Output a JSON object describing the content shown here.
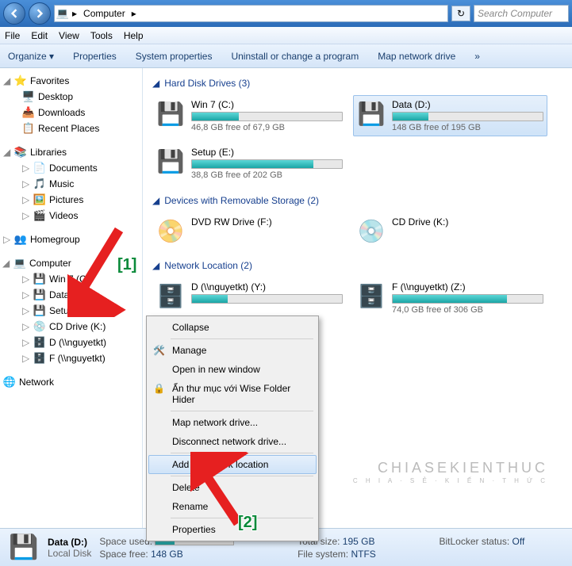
{
  "header": {
    "breadcrumb_root": "Computer",
    "search_placeholder": "Search Computer"
  },
  "menu": {
    "file": "File",
    "edit": "Edit",
    "view": "View",
    "tools": "Tools",
    "help": "Help"
  },
  "toolbar": {
    "organize": "Organize",
    "properties": "Properties",
    "sysprops": "System properties",
    "uninstall": "Uninstall or change a program",
    "mapdrive": "Map network drive",
    "overflow": "»"
  },
  "tree": {
    "favorites": {
      "label": "Favorites",
      "items": [
        "Desktop",
        "Downloads",
        "Recent Places"
      ]
    },
    "libraries": {
      "label": "Libraries",
      "items": [
        "Documents",
        "Music",
        "Pictures",
        "Videos"
      ]
    },
    "homegroup": {
      "label": "Homegroup"
    },
    "computer": {
      "label": "Computer",
      "items": [
        "Win 7 (C:)",
        "Data (D:)",
        "Setup (E:)",
        "CD Drive (K:)",
        "D (\\\\nguyetkt)",
        "F (\\\\nguyetkt)"
      ]
    },
    "network": {
      "label": "Network"
    }
  },
  "sections": {
    "hdd": "Hard Disk Drives (3)",
    "removable": "Devices with Removable Storage (2)",
    "netloc": "Network Location (2)"
  },
  "drives": {
    "hdd": [
      {
        "name": "Win 7 (C:)",
        "free": "46,8 GB free of 67,9 GB",
        "pct": 31
      },
      {
        "name": "Data (D:)",
        "free": "148 GB free of 195 GB",
        "pct": 24,
        "selected": true
      },
      {
        "name": "Setup (E:)",
        "free": "38,8 GB free of 202 GB",
        "pct": 81
      }
    ],
    "removable": [
      {
        "name": "DVD RW Drive (F:)"
      },
      {
        "name": "CD Drive (K:)"
      }
    ],
    "netloc": [
      {
        "name": "D (\\\\nguyetkt) (Y:)",
        "free": "",
        "pct": 24
      },
      {
        "name": "F (\\\\nguyetkt) (Z:)",
        "free": "74,0 GB free of 306 GB",
        "pct": 76
      }
    ]
  },
  "context_menu": {
    "collapse": "Collapse",
    "manage": "Manage",
    "open_new": "Open in new window",
    "wise_hider": "Ẩn thư mục với Wise Folder Hider",
    "map": "Map network drive...",
    "disconnect": "Disconnect network drive...",
    "add_netloc": "Add a network location",
    "delete": "Delete",
    "rename": "Rename",
    "properties": "Properties"
  },
  "status": {
    "title": "Data (D:)",
    "subtitle": "Local Disk",
    "space_used_label": "Space used:",
    "space_used_pct": 24,
    "space_free_label": "Space free:",
    "space_free": "148 GB",
    "total_label": "Total size:",
    "total": "195 GB",
    "fs_label": "File system:",
    "fs": "NTFS",
    "bitlocker_label": "BitLocker status:",
    "bitlocker": "Off"
  },
  "annotations": {
    "one": "[1]",
    "two": "[2]"
  },
  "watermark": {
    "main": "CHIASEKIENTHUC",
    "sub": "C H I A · S Ẻ · K I Ế N · T H Ứ C"
  }
}
